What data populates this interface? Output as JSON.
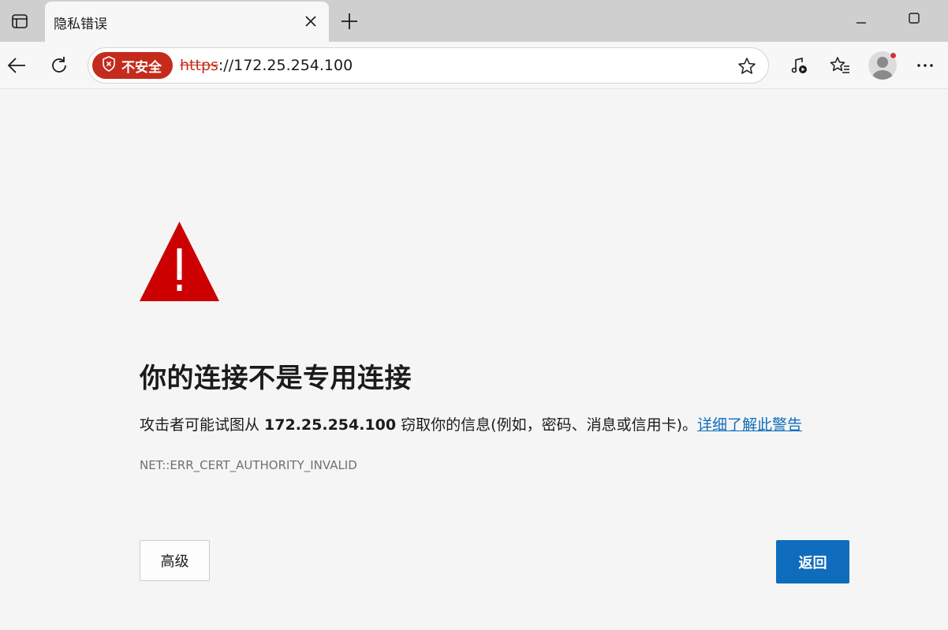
{
  "browser": {
    "tab": {
      "title": "隐私错误"
    },
    "address_bar": {
      "security_label": "不安全",
      "url_scheme": "https",
      "url_rest": "://172.25.254.100"
    },
    "icons": {
      "tab_actions": "tab-actions-icon",
      "tab_close": "close-icon",
      "new_tab": "plus-icon",
      "minimize": "minimize-icon",
      "maximize": "maximize-icon",
      "back": "back-arrow-icon",
      "refresh": "refresh-icon",
      "shield": "shield-icon",
      "favorite": "star-icon",
      "media": "music-note-icon",
      "favorites_list": "favorites-icon",
      "profile": "avatar",
      "more": "more-icon"
    }
  },
  "page": {
    "heading": "你的连接不是专用连接",
    "description_prefix": "攻击者可能试图从 ",
    "description_host": "172.25.254.100",
    "description_suffix": " 窃取你的信息(例如，密码、消息或信用卡)。",
    "learn_more_link": "详细了解此警告",
    "error_code": "NET::ERR_CERT_AUTHORITY_INVALID",
    "advanced_button": "高级",
    "back_button": "返回"
  },
  "colors": {
    "danger": "#c42b1c",
    "warning_triangle": "#cc0000",
    "accent": "#0f6cbd",
    "page_background": "#f5f5f5"
  }
}
